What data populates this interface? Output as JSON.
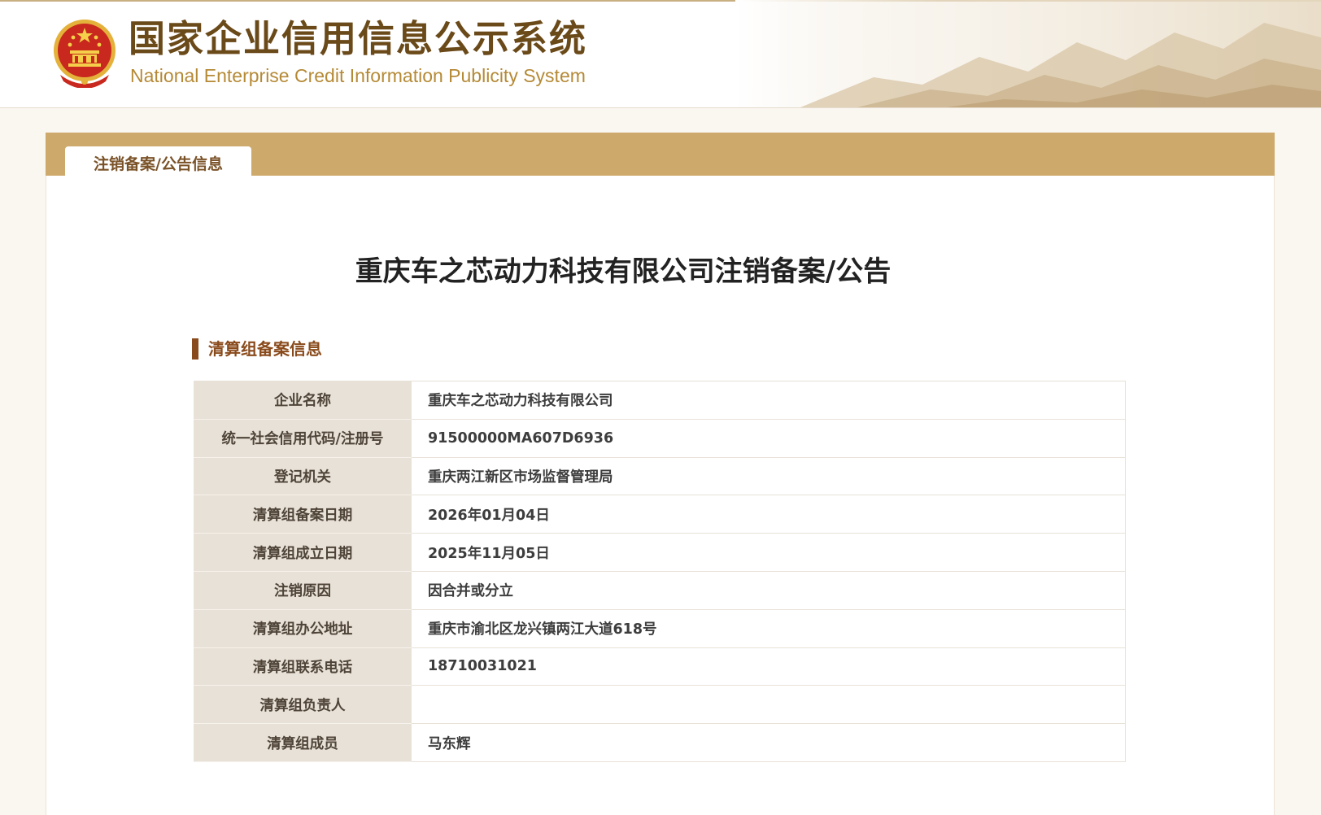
{
  "header": {
    "title_cn": "国家企业信用信息公示系统",
    "title_en": "National Enterprise Credit Information Publicity System"
  },
  "tab": {
    "label": "注销备案/公告信息"
  },
  "page": {
    "title": "重庆车之芯动力科技有限公司注销备案/公告"
  },
  "section": {
    "title": "清算组备案信息"
  },
  "rows": [
    {
      "label": "企业名称",
      "value": "重庆车之芯动力科技有限公司"
    },
    {
      "label": "统一社会信用代码/注册号",
      "value": "91500000MA607D6936"
    },
    {
      "label": "登记机关",
      "value": "重庆两江新区市场监督管理局"
    },
    {
      "label": "清算组备案日期",
      "value": "2026年01月04日"
    },
    {
      "label": "清算组成立日期",
      "value": "2025年11月05日"
    },
    {
      "label": "注销原因",
      "value": "因合并或分立"
    },
    {
      "label": "清算组办公地址",
      "value": "重庆市渝北区龙兴镇两江大道618号"
    },
    {
      "label": "清算组联系电话",
      "value": "18710031021"
    },
    {
      "label": "清算组负责人",
      "value": ""
    },
    {
      "label": "清算组成员",
      "value": "马东辉"
    }
  ],
  "colors": {
    "band": "#cda96c",
    "accent": "#8a4b1c",
    "label_bg": "#e8e1d7",
    "title_brown": "#6b4a1a",
    "title_gold": "#b58a36"
  },
  "icons": {
    "emblem": "national-emblem-icon"
  }
}
